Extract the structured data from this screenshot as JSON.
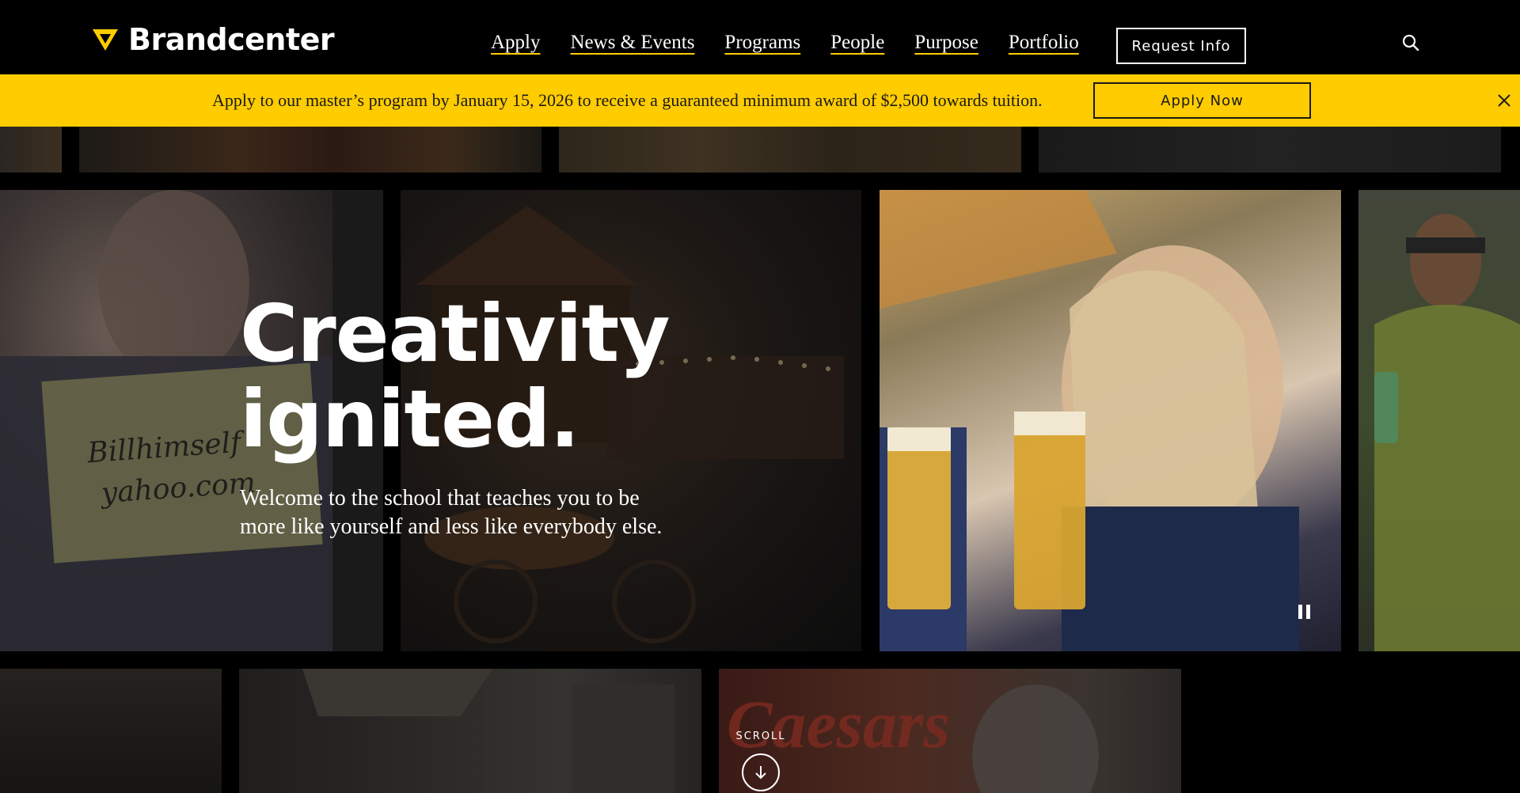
{
  "header": {
    "logo_text": "Brandcenter",
    "nav": [
      "Apply",
      "News & Events",
      "Programs",
      "People",
      "Purpose",
      "Portfolio"
    ],
    "request_info": "Request Info"
  },
  "banner": {
    "message": "Apply to our master’s program by January 15, 2026 to receive a guaranteed minimum award of $2,500 towards tuition.",
    "cta": "Apply Now"
  },
  "hero": {
    "title_line1": "Creativity",
    "title_line2": "ignited.",
    "subtitle": "Welcome to the school that teaches you to be more like yourself and less like everybody else.",
    "sign_text_line1": "Billhimself",
    "sign_text_line2": "yahoo.com",
    "storefront_text": "Caesars"
  },
  "scroll": {
    "label": "SCROLL"
  },
  "colors": {
    "accent": "#ffcc00",
    "background": "#000000",
    "text": "#ffffff"
  },
  "icons": {
    "logo": "triangle-logo-icon",
    "search": "search-icon",
    "close": "close-icon",
    "pause": "pause-icon",
    "scroll": "arrow-down-icon"
  }
}
